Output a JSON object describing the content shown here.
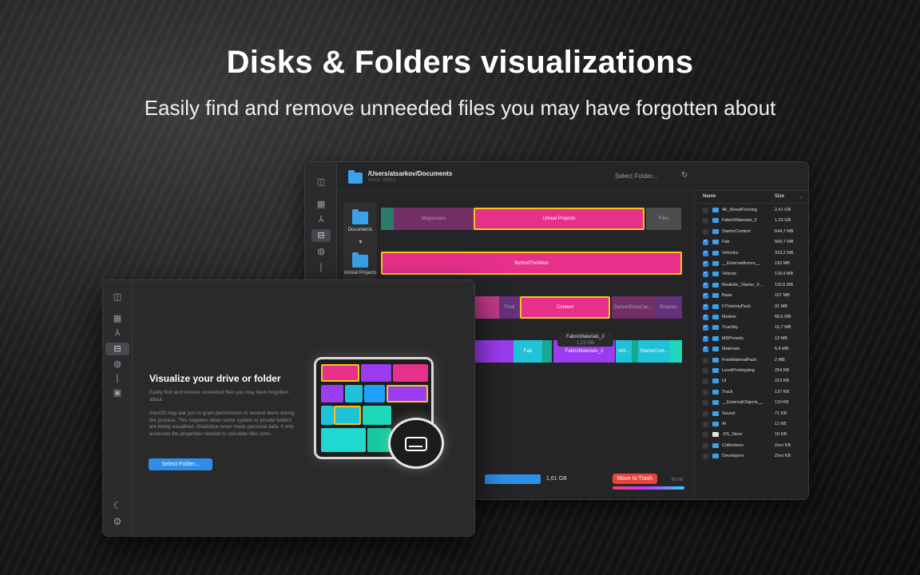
{
  "hero": {
    "title": "Disks & Folders visualizations",
    "subtitle": "Easily find and remove unneeded files you may have forgotten about"
  },
  "back_window": {
    "path": "/Users/atsarkov/Documents",
    "path_sub": "Items: 58912",
    "select_folder": "Select Folder...",
    "refresh_icon": "↻",
    "breadcrumbs": [
      "Documents",
      "Unreal Projects"
    ],
    "bars": {
      "row1": [
        "Megascans",
        "Unreal Projects",
        "Files"
      ],
      "row2": [
        "BehindTheWest"
      ],
      "row3": [
        "Pixel",
        "Content",
        "DerivedDataCac...",
        "Binaries"
      ],
      "row4": [
        "Fab",
        "FabricMaterials_2",
        "Veh...",
        "StarterCont..."
      ]
    },
    "tooltip": {
      "name": "FabricMaterials_2",
      "size": "1,23 GB"
    },
    "total_size": "1,61 GB",
    "move_to_trash": "Move to Trash",
    "gauge_label": "60 GB",
    "list_header": {
      "name": "Name",
      "size": "Size"
    },
    "files": [
      {
        "name": "4K_WoodFlooring",
        "size": "2,41 GB",
        "checked": false,
        "type": "folder"
      },
      {
        "name": "FabricMaterials_2",
        "size": "1,23 GB",
        "checked": false,
        "type": "folder"
      },
      {
        "name": "StarterContent",
        "size": "644,7 MB",
        "checked": false,
        "type": "folder"
      },
      {
        "name": "Fab",
        "size": "569,7 MB",
        "checked": true,
        "type": "folder"
      },
      {
        "name": "Vehicles",
        "size": "319,2 MB",
        "checked": true,
        "type": "folder"
      },
      {
        "name": "__ExternalActors__",
        "size": "193 MB",
        "checked": true,
        "type": "folder"
      },
      {
        "name": "Vefects",
        "size": "118,4 MB",
        "checked": true,
        "type": "folder"
      },
      {
        "name": "Realistic_Starter_V...",
        "size": "115,6 MB",
        "checked": true,
        "type": "folder"
      },
      {
        "name": "Base",
        "size": "107 MB",
        "checked": true,
        "type": "folder"
      },
      {
        "name": "FXVarietyPack",
        "size": "91 MB",
        "checked": true,
        "type": "folder"
      },
      {
        "name": "Models",
        "size": "68,6 MB",
        "checked": true,
        "type": "folder"
      },
      {
        "name": "TrueSky",
        "size": "15,7 MB",
        "checked": true,
        "type": "folder"
      },
      {
        "name": "MSPresets",
        "size": "12 MB",
        "checked": true,
        "type": "folder"
      },
      {
        "name": "Materials",
        "size": "6,4 MB",
        "checked": true,
        "type": "folder"
      },
      {
        "name": "FreeMaterialPack",
        "size": "2 MB",
        "checked": false,
        "type": "folder"
      },
      {
        "name": "LevelPrototyping",
        "size": "254 KB",
        "checked": false,
        "type": "folder"
      },
      {
        "name": "UI",
        "size": "213 KB",
        "checked": false,
        "type": "folder"
      },
      {
        "name": "Track",
        "size": "137 KB",
        "checked": false,
        "type": "folder"
      },
      {
        "name": "__ExternalObjects__",
        "size": "110 KB",
        "checked": false,
        "type": "folder"
      },
      {
        "name": "Sound",
        "size": "71 KB",
        "checked": false,
        "type": "folder"
      },
      {
        "name": "AI",
        "size": "11 KB",
        "checked": false,
        "type": "folder"
      },
      {
        "name": ".DS_Store",
        "size": "10 KB",
        "checked": false,
        "type": "file"
      },
      {
        "name": "Collections",
        "size": "Zero KB",
        "checked": false,
        "type": "folder"
      },
      {
        "name": "Developers",
        "size": "Zero KB",
        "checked": false,
        "type": "folder"
      }
    ]
  },
  "front_window": {
    "title": "Visualize your drive or folder",
    "desc1": "Easily find and remove unneeded files you may have forgotten about.",
    "desc2": "macOS may ask you to grant permissions to several items during the process. This happens when some system or private folders are being visualized. iStatistica never reads personal data, it only accesses the properties needed to calculate files sizes.",
    "button": "Select Folder..."
  },
  "sidebar_icons": [
    "overview-icon",
    "network-icon",
    "disk-icon",
    "globe-icon",
    "temperature-icon",
    "cube-icon"
  ],
  "sidebar_glyphs": [
    "▦",
    "⅄",
    "⊟",
    "◍",
    "❘",
    "▣"
  ],
  "sidebar_extra": {
    "moon": "☾",
    "gear": "⚙",
    "toggle": "◫"
  },
  "colors": {
    "accent": "#2f8fe8",
    "pink": "#e6308a",
    "purple": "#9b3cf0",
    "cyan": "#1fc2d8",
    "trash": "#e8443b",
    "highlight": "#f5c518"
  }
}
